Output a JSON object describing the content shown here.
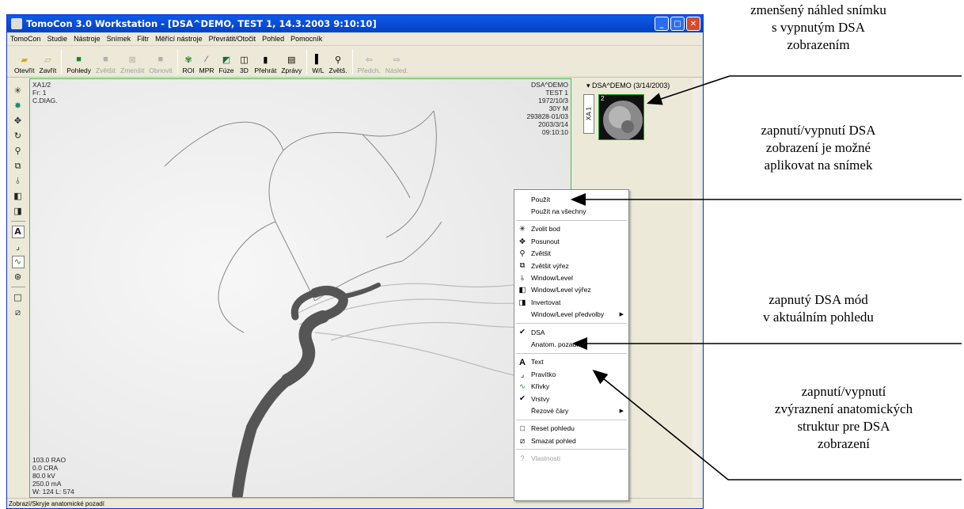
{
  "window": {
    "title": "TomoCon 3.0 Workstation - [DSA^DEMO, TEST 1, 14.3.2003 9:10:10]",
    "controls": {
      "minimize": "_",
      "maximize": "□",
      "close": "✕"
    }
  },
  "menubar": [
    "TomoCon",
    "Studie",
    "Nástroje",
    "Snímek",
    "Filtr",
    "Měřící nástroje",
    "Převrátit/Otočit",
    "Pohled",
    "Pomocník"
  ],
  "toolbar": [
    {
      "label": "Otevřít",
      "icon": "open-folder-icon",
      "enabled": true
    },
    {
      "label": "Zavřít",
      "icon": "close-folder-icon",
      "enabled": true
    },
    {
      "label": "Pohledy",
      "icon": "views-icon",
      "enabled": true
    },
    {
      "label": "Zvětšit",
      "icon": "maximize-view-icon",
      "enabled": false
    },
    {
      "label": "Zmenšit",
      "icon": "minimize-view-icon",
      "enabled": false
    },
    {
      "label": "Obnovit",
      "icon": "restore-view-icon",
      "enabled": false
    },
    {
      "label": "ROI",
      "icon": "roi-icon",
      "enabled": true
    },
    {
      "label": "MPR",
      "icon": "mpr-icon",
      "enabled": true
    },
    {
      "label": "Fúze",
      "icon": "fusion-icon",
      "enabled": true
    },
    {
      "label": "3D",
      "icon": "3d-icon",
      "enabled": true
    },
    {
      "label": "Přehrát",
      "icon": "play-icon",
      "enabled": true
    },
    {
      "label": "Zprávy",
      "icon": "reports-icon",
      "enabled": true
    },
    {
      "label": "W/L",
      "icon": "window-level-icon",
      "enabled": true
    },
    {
      "label": "Zvětš.",
      "icon": "zoom-icon",
      "enabled": true
    },
    {
      "label": "Předch.",
      "icon": "prev-arrow-icon",
      "enabled": false
    },
    {
      "label": "Násled.",
      "icon": "next-arrow-icon",
      "enabled": false
    }
  ],
  "viewport": {
    "overlay_tl": [
      "XA1/2",
      "Fr: 1",
      "C.DIAG."
    ],
    "overlay_tr": [
      "DSA^DEMO",
      "TEST 1",
      "1972/10/3",
      "30Y M",
      "293828-01/03",
      "2003/3/14",
      "09:10:10"
    ],
    "overlay_bl": [
      "103.0 RAO",
      "0.0 CRA",
      "80.0 kV",
      "250.0 mA",
      "W: 124 L: 574"
    ]
  },
  "thumbnails": {
    "study_label": "▾ DSA^DEMO (3/14/2003)",
    "series_tab": "XA 1",
    "thumb_number": "2"
  },
  "status_text": "Zobrazí/Skryje anatomické pozadí",
  "context_menu": [
    {
      "label": "Použít",
      "type": "item"
    },
    {
      "label": "Použít na všechny",
      "type": "item"
    },
    {
      "type": "sep"
    },
    {
      "label": "Zvolit bod",
      "type": "item",
      "icon": "select-point-icon"
    },
    {
      "label": "Posunout",
      "type": "item",
      "icon": "pan-icon"
    },
    {
      "label": "Zvětšit",
      "type": "item",
      "icon": "zoom-icon"
    },
    {
      "label": "Zvětšit výřez",
      "type": "item",
      "icon": "zoom-region-icon"
    },
    {
      "label": "Window/Level",
      "type": "item",
      "icon": "window-level-icon"
    },
    {
      "label": "Window/Level výřez",
      "type": "item",
      "icon": "window-level-region-icon"
    },
    {
      "label": "Invertovat",
      "type": "item",
      "icon": "invert-icon"
    },
    {
      "label": "Window/Level předvolby",
      "type": "submenu"
    },
    {
      "type": "sep"
    },
    {
      "label": "DSA",
      "type": "item",
      "checked": true
    },
    {
      "label": "Anatom. pozadí",
      "type": "item"
    },
    {
      "type": "sep"
    },
    {
      "label": "Text",
      "type": "item",
      "icon": "text-icon"
    },
    {
      "label": "Pravítko",
      "type": "item",
      "icon": "ruler-icon"
    },
    {
      "label": "Křivky",
      "type": "item",
      "icon": "curves-icon"
    },
    {
      "label": "Vrstvy",
      "type": "item",
      "checked": true
    },
    {
      "label": "Řezové čáry",
      "type": "submenu"
    },
    {
      "type": "sep"
    },
    {
      "label": "Reset pohledu",
      "type": "item",
      "icon": "reset-view-icon"
    },
    {
      "label": "Smazat pohled",
      "type": "item",
      "icon": "delete-view-icon"
    },
    {
      "type": "sep"
    },
    {
      "label": "Vlastnosti",
      "type": "item",
      "icon": "properties-icon",
      "disabled": true
    }
  ],
  "annotations": {
    "a1": [
      "zmenšený náhled snímku",
      "s vypnutým DSA",
      "zobrazením"
    ],
    "a2": [
      "zapnutí/vypnutí DSA",
      "zobrazení je možné",
      "aplikovat na snímek"
    ],
    "a3": [
      "zapnutý DSA mód",
      "v aktuálním pohledu"
    ],
    "a4": [
      "zapnutí/vypnutí",
      "zvýraznení anatomických",
      "struktur pre DSA",
      "zobrazení"
    ]
  }
}
